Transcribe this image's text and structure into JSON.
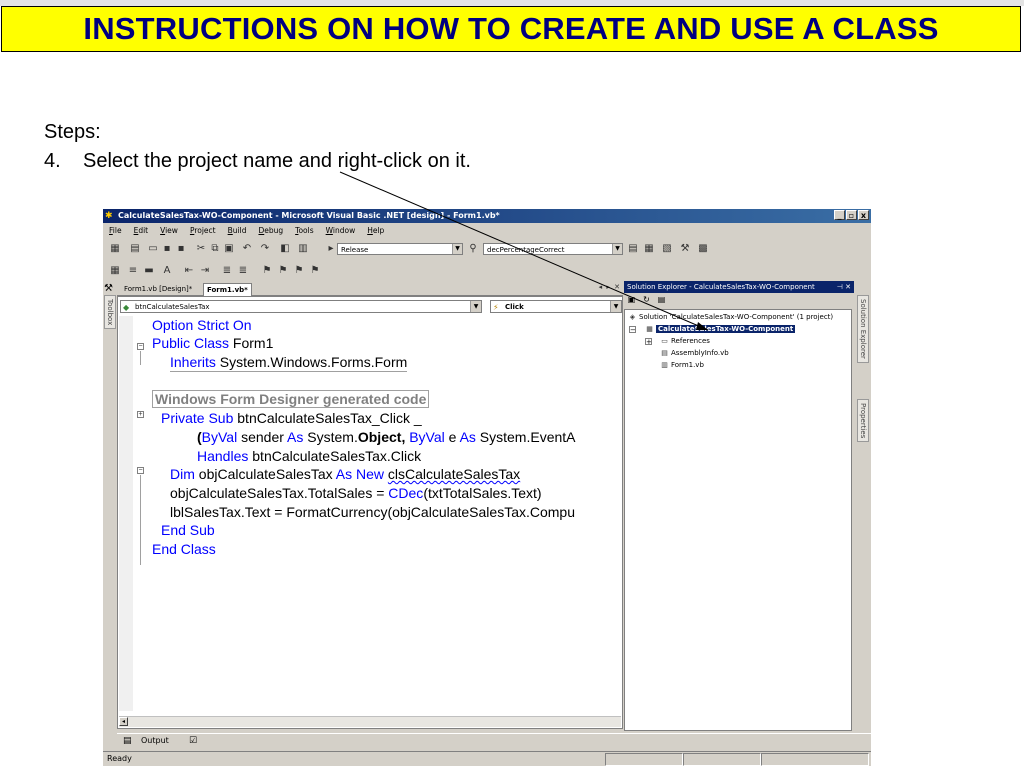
{
  "slide": {
    "title": "INSTRUCTIONS ON HOW TO CREATE AND USE A CLASS",
    "steps_label": "Steps:",
    "step_number": "4.",
    "step_text": "Select the project name and right-click on it."
  },
  "colors": {
    "title_background": "#ffff00",
    "title_text": "#000080",
    "keyword": "#0000ff",
    "selection": "#0a246a"
  },
  "window": {
    "title": "CalculateSalesTax-WO-Component - Microsoft Visual Basic .NET [design] - Form1.vb*",
    "controls": [
      "_",
      "▫",
      "x"
    ]
  },
  "menu": [
    "File",
    "Edit",
    "View",
    "Project",
    "Build",
    "Debug",
    "Tools",
    "Window",
    "Help"
  ],
  "toolbar": {
    "config_value": "Release",
    "find_value": "decPercentageCorrect"
  },
  "side_tabs": {
    "toolbox": "Toolbox",
    "solution_explorer": "Solution Explorer",
    "properties": "Properties"
  },
  "doc_tabs": [
    {
      "label": "Form1.vb [Design]*"
    },
    {
      "label": "Form1.vb*"
    }
  ],
  "editor": {
    "class_combo": "btnCalculateSalesTax",
    "method_combo": "Click",
    "lines": {
      "l1_kw": "Option Strict On",
      "l2_kw": "Public Class",
      "l2_t": " Form1",
      "l3_kw": "Inherits",
      "l3_t": " System.Windows.Forms.Form",
      "l4_region": "Windows Form Designer generated code",
      "l5_kw": "Private Sub",
      "l5_t": " btnCalculateSalesTax_Click _",
      "l6_a": "(",
      "l6_kw1": "ByVal",
      "l6_b": " sender ",
      "l6_kw2": "As",
      "l6_c": " System.",
      "l6_bold": "Object",
      "l6_d": ", ",
      "l6_kw3": "ByVal",
      "l6_e": " e ",
      "l6_kw4": "As",
      "l6_f": " System.EventA",
      "l7_kw": "Handles",
      "l7_t": " btnCalculateSalesTax.Click",
      "l8_kw1": "Dim",
      "l8_a": " objCalculateSalesTax ",
      "l8_kw2": "As New",
      "l8_sp": " ",
      "l8_sq": "clsCalculateSalesTax",
      "l9_a": "objCalculateSalesTax.TotalSales = ",
      "l9_kw": "CDec",
      "l9_b": "(txtTotalSales.Text)",
      "l10_t": "lblSalesTax.Text = FormatCurrency(objCalculateSalesTax.Compu",
      "l11_kw": "End Sub",
      "l12_kw": "End Class"
    }
  },
  "solution_explorer": {
    "title": "Solution Explorer - CalculateSalesTax-WO-Component",
    "title_controls": "⊣ ✕",
    "solution": "Solution 'CalculateSalesTax-WO-Component' (1 project)",
    "project": "CalculateSalesTax-WO-Component",
    "items": [
      "References",
      "AssemblyInfo.vb",
      "Form1.vb"
    ]
  },
  "bottom": {
    "output_tab": "Output",
    "status": "Ready"
  }
}
